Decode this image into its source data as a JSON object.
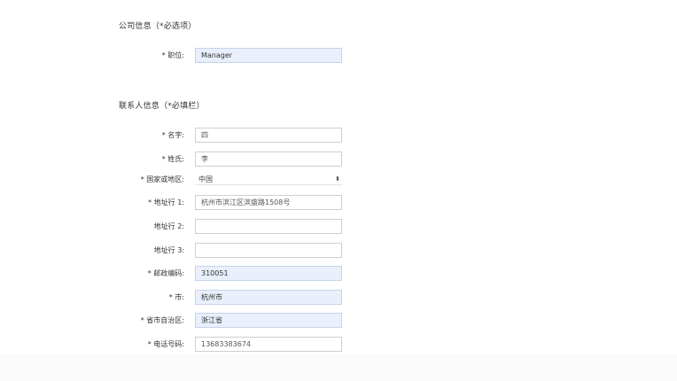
{
  "company_section": {
    "title": "公司信息（*必选项）",
    "position_label": "* 职位:",
    "position_value": "Manager"
  },
  "contact_section": {
    "title": "联系人信息（*必填栏）",
    "fields": {
      "first_name": {
        "label": "* 名字:",
        "value": "四"
      },
      "last_name": {
        "label": "* 姓氏:",
        "value": "李"
      },
      "country": {
        "label": "* 国家或地区:",
        "value": "中国"
      },
      "address1": {
        "label": "* 地址行 1:",
        "value": "杭州市滨江区滨盛路1508号"
      },
      "address2": {
        "label": "地址行 2:",
        "value": ""
      },
      "address3": {
        "label": "地址行 3:",
        "value": ""
      },
      "postal_code": {
        "label": "* 邮政编码:",
        "value": "310051"
      },
      "city": {
        "label": "* 市:",
        "value": "杭州市"
      },
      "province": {
        "label": "* 省市自治区:",
        "value": "浙江省"
      },
      "phone": {
        "label": "* 电话号码:",
        "value": "13683383674"
      }
    }
  },
  "icons": {
    "select_arrow": "⬍"
  }
}
